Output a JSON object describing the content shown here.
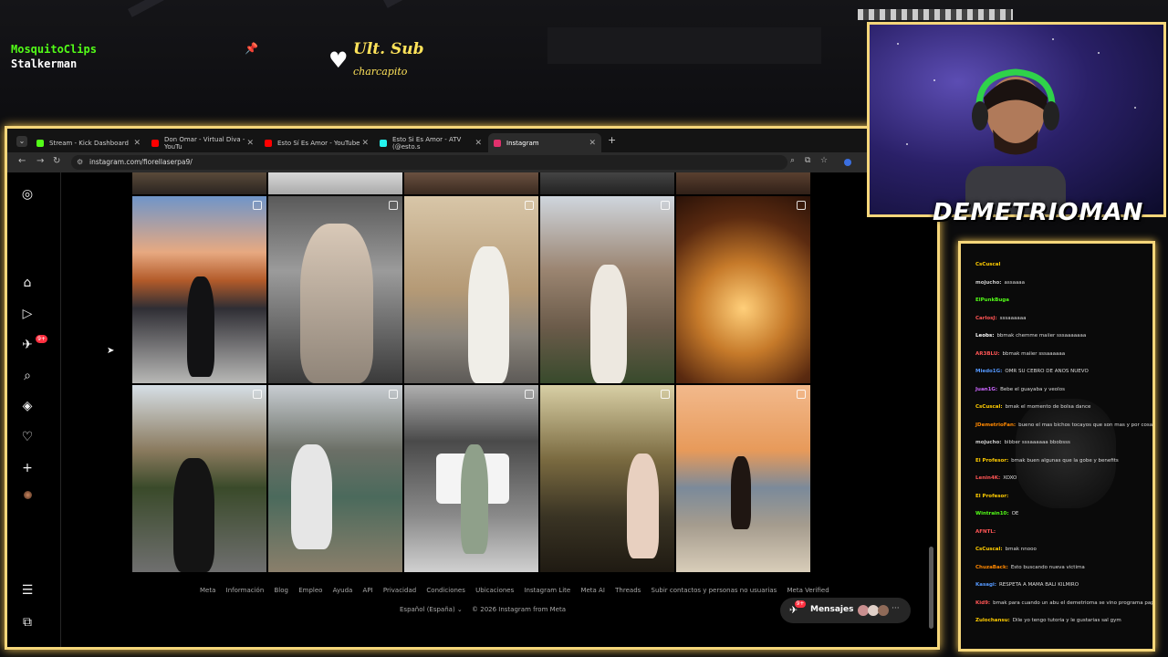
{
  "stream_overlay": {
    "recent_names": [
      "MosquitoClips",
      "Stalkerman"
    ],
    "last_sub_title": "Ult. Sub",
    "last_sub_name": "charcapito",
    "streamer_name": "DEMETRIOMAN"
  },
  "browser": {
    "tabs": [
      {
        "label": "Stream - Kick Dashboard",
        "color": "#53fc18"
      },
      {
        "label": "Don Omar - Virtual Diva - YouTu",
        "color": "#ff0000"
      },
      {
        "label": "Esto Sí Es Amor - YouTube",
        "color": "#ff0000"
      },
      {
        "label": "Esto Si Es Amor - ATV (@esto.s",
        "color": "#25f4ee"
      },
      {
        "label": "Instagram",
        "color": "#e1306c"
      }
    ],
    "url": "instagram.com/fiorellaserpa9/"
  },
  "instagram": {
    "sidebar_badge": "9+",
    "footer_links": [
      "Meta",
      "Información",
      "Blog",
      "Empleo",
      "Ayuda",
      "API",
      "Privacidad",
      "Condiciones",
      "Ubicaciones",
      "Instagram Lite",
      "Meta AI",
      "Threads",
      "Subir contactos y personas no usuarias",
      "Meta Verified"
    ],
    "language": "Español (España)",
    "copyright": "© 2026 Instagram from Meta",
    "messages_label": "Mensajes",
    "messages_badge": "9+"
  },
  "chat": {
    "messages": [
      {
        "user": "CsCuscal",
        "text": "",
        "color": "#ffcc00"
      },
      {
        "user": "mojucho:",
        "text": "assaaaa",
        "color": "#cccccc"
      },
      {
        "user": "ElPunkBuga",
        "text": "",
        "color": "#53fc18"
      },
      {
        "user": "CarlosJ:",
        "text": "sssaaaaaa",
        "color": "#ff5555"
      },
      {
        "user": "Leobs:",
        "text": "bbmak chemme maiier sssaaaaaaa",
        "color": "#ffffff"
      },
      {
        "user": "AR3BLU:",
        "text": "bbmak maiier sssaaaaaa",
        "color": "#ff5555"
      },
      {
        "user": "Miedo1G:",
        "text": "OMR SU CEBRO DE ANOS NUEVO",
        "color": "#5599ff"
      },
      {
        "user": "Juan1G:",
        "text": "Bebe el guayaba y veolos",
        "color": "#cc66ff"
      },
      {
        "user": "CsCuscal:",
        "text": "bmak el momento de bolsa dance",
        "color": "#ffcc00"
      },
      {
        "user": "JDemetrioFan:",
        "text": "bueno el mas bichos tocayos que son mas y por cosas",
        "color": "#ff8800"
      },
      {
        "user": "mojucho:",
        "text": "bibber sssaaaaaa bbobsss",
        "color": "#cccccc"
      },
      {
        "user": "El Profesor:",
        "text": "bmak buen algunas que la gobe y benefits",
        "color": "#ffcc00"
      },
      {
        "user": "Lenin4K:",
        "text": "XOXO",
        "color": "#ff5555"
      },
      {
        "user": "El Profesor:",
        "text": "",
        "color": "#ffcc00"
      },
      {
        "user": "Wintrain10:",
        "text": "OE",
        "color": "#53fc18"
      },
      {
        "user": "AFNTL:",
        "text": "",
        "color": "#ff5555"
      },
      {
        "user": "CsCuscal:",
        "text": "bmak nnooo",
        "color": "#ffcc00"
      },
      {
        "user": "ChuzaBack:",
        "text": "Esto buscando nueva victima",
        "color": "#ff8800"
      },
      {
        "user": "Kasagi:",
        "text": "RESPETA A MAMA BALI KILMIRO",
        "color": "#5599ff"
      },
      {
        "user": "Kid9:",
        "text": "bmak para cuando un abu el demetrioma se vino programa papa",
        "color": "#ff5555"
      },
      {
        "user": "Zulochansu:",
        "text": "Dile yo tengo tutoria y le gustarias sal gym",
        "color": "#ffcc00"
      }
    ]
  }
}
